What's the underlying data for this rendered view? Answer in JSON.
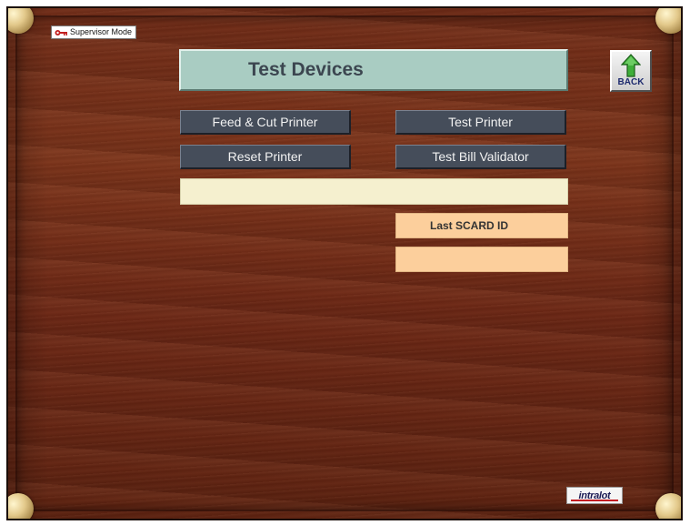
{
  "mode_badge": {
    "label": "Supervisor Mode",
    "icon": "key-icon"
  },
  "header": {
    "title": "Test Devices"
  },
  "back_button": {
    "label": "BACK",
    "icon": "green-up-arrow-icon"
  },
  "buttons": {
    "feed_cut_printer": "Feed & Cut Printer",
    "test_printer": "Test Printer",
    "reset_printer": "Reset Printer",
    "test_bill_validator": "Test Bill Validator"
  },
  "status_field": {
    "value": ""
  },
  "scard": {
    "label": "Last SCARD ID",
    "value": ""
  },
  "brand": {
    "logo_text": "intralot"
  },
  "colors": {
    "title_bar": "#a9ccc2",
    "button_bg": "#454d5a",
    "status_field": "#f5f0cf",
    "scard_fields": "#fccf9c",
    "wood": "#6e2a16"
  }
}
